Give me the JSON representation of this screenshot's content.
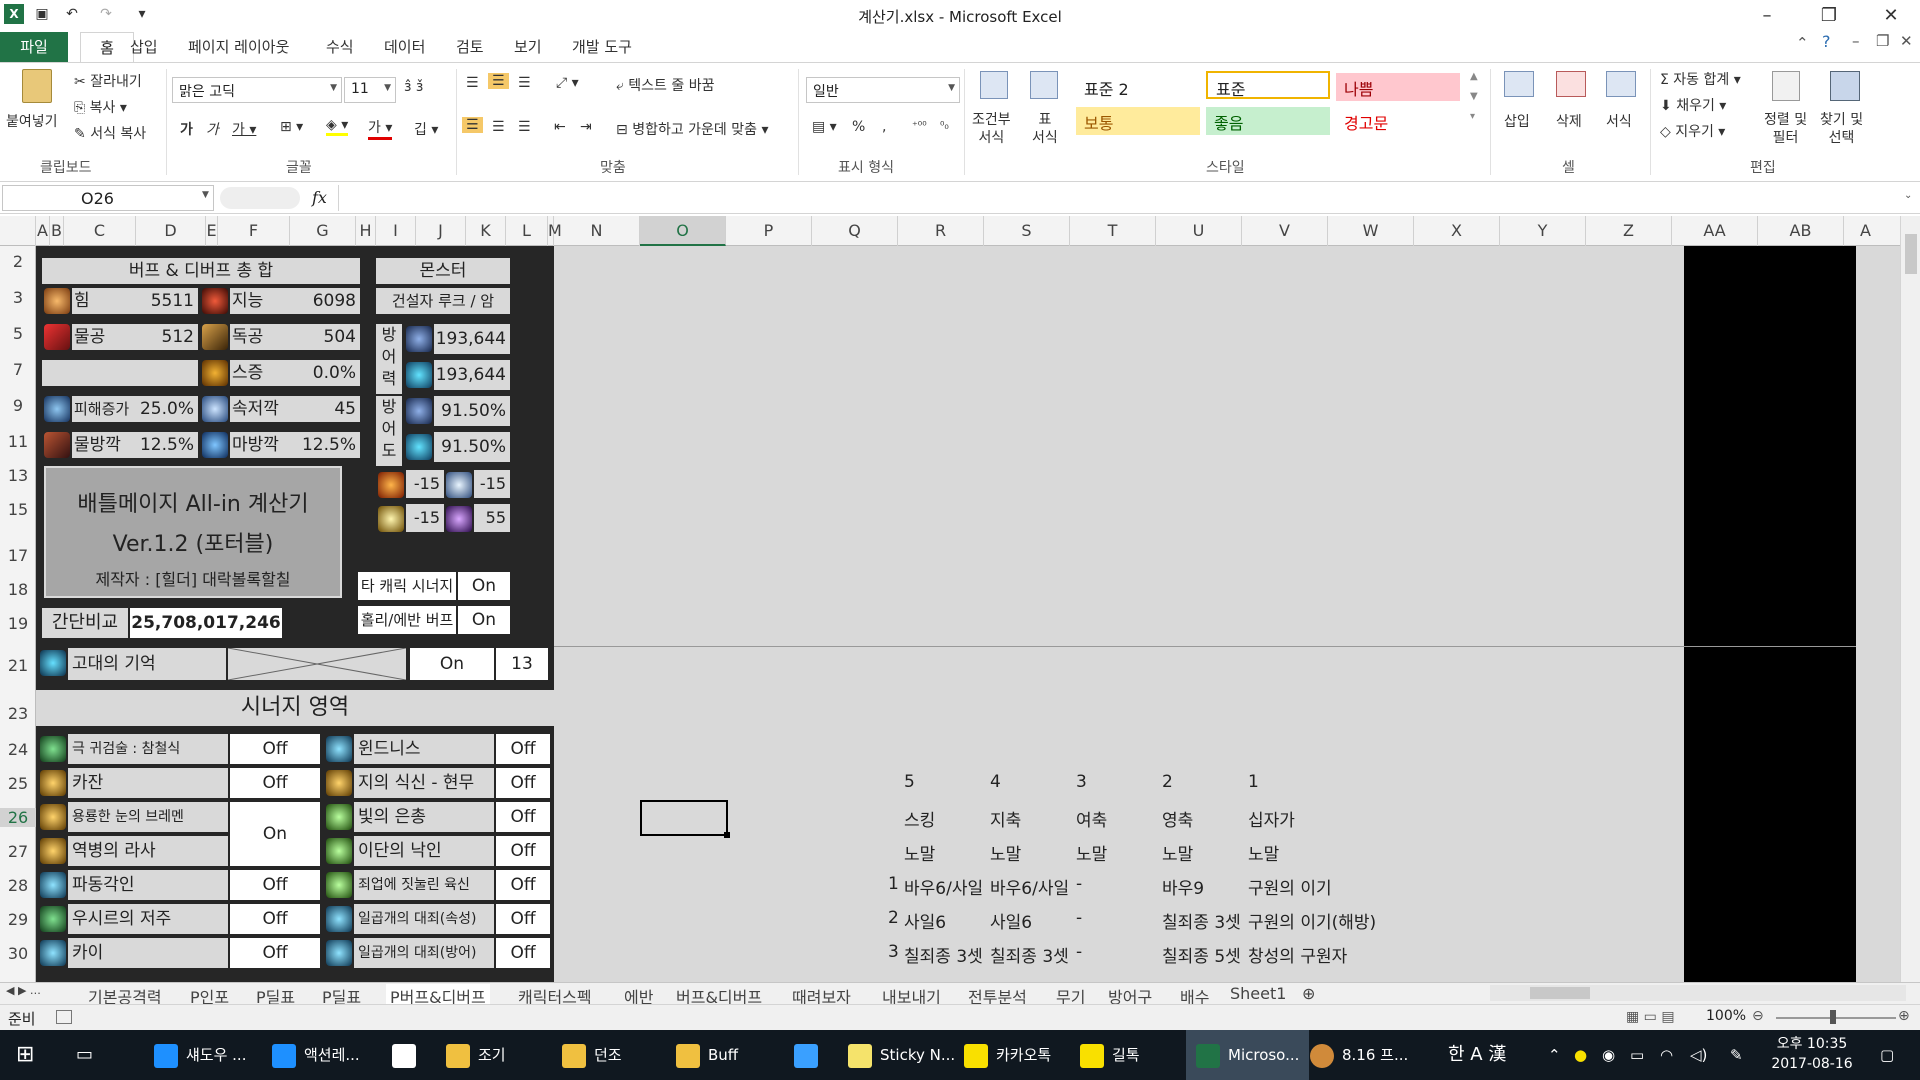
{
  "window": {
    "title": "계산기.xlsx  -  Microsoft Excel"
  },
  "ribbon_tabs": [
    "파일",
    "홈",
    "삽입",
    "페이지 레이아웃",
    "수식",
    "데이터",
    "검토",
    "보기",
    "개발 도구"
  ],
  "clipboard": {
    "paste": "붙여넣기",
    "cut": "잘라내기",
    "copy": "복사",
    "format_painter": "서식 복사",
    "group": "클립보드"
  },
  "font": {
    "name": "맑은 고딕",
    "size": "11",
    "group": "글꼴"
  },
  "alignment": {
    "wrap": "텍스트 줄 바꿈",
    "merge": "병합하고 가운데 맞춤",
    "group": "맞춤"
  },
  "number": {
    "format": "일반",
    "group": "표시 형식"
  },
  "styles": {
    "conditional": "조건부\n서식",
    "table": "표\n서식",
    "items": [
      "표준 2",
      "표준",
      "나쁨",
      "보통",
      "좋음",
      "경고문"
    ],
    "group": "스타일"
  },
  "cells": {
    "insert": "삽입",
    "delete": "삭제",
    "format": "서식",
    "group": "셀"
  },
  "editing": {
    "autosum": "자동 합계",
    "fill": "채우기",
    "clear": "지우기",
    "sort": "정렬 및\n필터",
    "find": "찾기 및\n선택",
    "group": "편집"
  },
  "formula_bar": {
    "name_box": "O26",
    "fx": "fx",
    "value": ""
  },
  "columns": [
    "A",
    "B",
    "C",
    "D",
    "E",
    "F",
    "G",
    "H",
    "I",
    "J",
    "K",
    "L",
    "M",
    "N",
    "O",
    "P",
    "Q",
    "R",
    "S",
    "T",
    "U",
    "V",
    "W",
    "X",
    "Y",
    "Z",
    "AA",
    "AB",
    "A"
  ],
  "rows": [
    "2",
    "3",
    "5",
    "7",
    "9",
    "11",
    "13",
    "15",
    "17",
    "18",
    "19",
    "21",
    "23",
    "24",
    "25",
    "26",
    "27",
    "28",
    "29",
    "30"
  ],
  "sheet": {
    "buff_title": "버프 & 디버프 총 합",
    "str_label": "힘",
    "str_val": "5511",
    "int_label": "지능",
    "int_val": "6098",
    "patk_label": "물공",
    "patk_val": "512",
    "iatk_label": "독공",
    "iatk_val": "504",
    "skill_label": "스증",
    "skill_val": "0.0%",
    "dmg_label": "피해증가",
    "dmg_val": "25.0%",
    "elem_label": "속저깍",
    "elem_val": "45",
    "pdef_label": "물방깍",
    "pdef_val": "12.5%",
    "mdef_label": "마방깍",
    "mdef_val": "12.5%",
    "monster_title": "몬스터",
    "monster_name": "건설자 루크 / 암",
    "def_label": "방\n어\n력",
    "def1": "193,644",
    "def2": "193,644",
    "defr_label": "방\n어\n도",
    "defr1": "91.50%",
    "defr2": "91.50%",
    "res_fire": "-15",
    "res_ice": "-15",
    "res_light": "-15",
    "res_dark": "55",
    "calc_title": "배틀메이지 All-in 계산기",
    "calc_ver": "Ver.1.2 (포터블)",
    "calc_author": "제작자 : [힐더] 대락볼록할칠",
    "other_syn_label": "타 캐릭 시너지",
    "other_syn_val": "On",
    "holy_label": "홀리/에반 버프",
    "holy_val": "On",
    "compare_label": "간단비교",
    "compare_val": "25,708,017,246",
    "ancient_label": "고대의 기억",
    "ancient_val": "On",
    "ancient_num": "13",
    "synergy_title": "시너지 영역",
    "syn_left": [
      {
        "name": "극 귀검술 : 참철식",
        "val": "Off"
      },
      {
        "name": "카잔",
        "val": "Off"
      },
      {
        "name": "용룡한 눈의 브레멘",
        "val": "On"
      },
      {
        "name": "역병의 라사",
        "val": ""
      },
      {
        "name": "파동각인",
        "val": "Off"
      },
      {
        "name": "우시르의 저주",
        "val": "Off"
      },
      {
        "name": "카이",
        "val": "Off"
      }
    ],
    "syn_right": [
      {
        "name": "윈드니스",
        "val": "Off"
      },
      {
        "name": "지의 식신 - 현무",
        "val": "Off"
      },
      {
        "name": "빛의 은총",
        "val": "Off"
      },
      {
        "name": "이단의 낙인",
        "val": "Off"
      },
      {
        "name": "죄업에 짓눌린 육신",
        "val": "Off"
      },
      {
        "name": "일곱개의 대죄(속성)",
        "val": "Off"
      },
      {
        "name": "일곱개의 대죄(방어)",
        "val": "Off"
      }
    ],
    "right_table": {
      "header_nums": [
        "5",
        "4",
        "3",
        "2",
        "1"
      ],
      "header_names": [
        "스킹",
        "지축",
        "여축",
        "영축",
        "십자가"
      ],
      "header_mode": [
        "노말",
        "노말",
        "노말",
        "노말",
        "노말"
      ],
      "rows": [
        {
          "n": "1",
          "c1": "바우6/사일",
          "c2": "바우6/사일",
          "c3": "-",
          "c4": "바우9",
          "c5": "구원의 이기"
        },
        {
          "n": "2",
          "c1": "사일6",
          "c2": "사일6",
          "c3": "-",
          "c4": "칠죄종 3셋",
          "c5": "구원의 이기(해방)"
        },
        {
          "n": "3",
          "c1": "칠죄종 3셋",
          "c2": "칠죄종 3셋",
          "c3": "-",
          "c4": "칠죄종 5셋",
          "c5": "창성의 구원자"
        }
      ]
    }
  },
  "sheet_tabs": [
    "기본공격력",
    "P인포",
    "P딜표",
    "P딜표",
    "P버프&디버프",
    "캐릭터스펙",
    "에반",
    "버프&디버프",
    "때려보자",
    "내보내기",
    "전투분석",
    "무기",
    "방어구",
    "배수",
    "Sheet1"
  ],
  "status": {
    "ready": "준비",
    "zoom": "100%"
  },
  "taskbar": {
    "items": [
      "섀도우 ...",
      "액션레...",
      "",
      "조기",
      "던조",
      "Buff",
      "",
      "Sticky N...",
      "카카오톡",
      "길톡",
      "Microso...",
      "8.16 프..."
    ],
    "ime": "한 A 漢",
    "time": "오후 10:35",
    "date": "2017-08-16"
  }
}
